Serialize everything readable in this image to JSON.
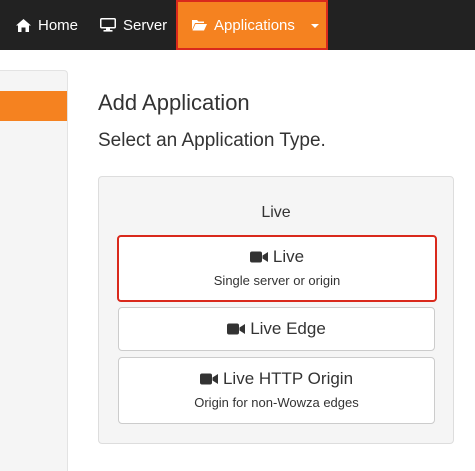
{
  "navbar": {
    "home_label": "Home",
    "server_label": "Server",
    "applications_label": "Applications",
    "accent_color": "#f58220",
    "highlight_color": "#d9291c",
    "background_color": "#222222",
    "icons": {
      "home": "home-icon",
      "server": "monitor-icon",
      "applications": "folder-open-icon",
      "dropdown": "caret-down-icon"
    }
  },
  "main": {
    "title": "Add Application",
    "subtitle": "Select an Application Type.",
    "panel": {
      "heading": "Live",
      "options": [
        {
          "title": "Live",
          "description": "Single server or origin",
          "icon": "video-camera-icon",
          "highlighted": true
        },
        {
          "title": "Live Edge",
          "description": "",
          "icon": "video-camera-icon",
          "highlighted": false
        },
        {
          "title": "Live HTTP Origin",
          "description": "Origin for non-Wowza edges",
          "icon": "video-camera-icon",
          "highlighted": false
        }
      ]
    }
  }
}
